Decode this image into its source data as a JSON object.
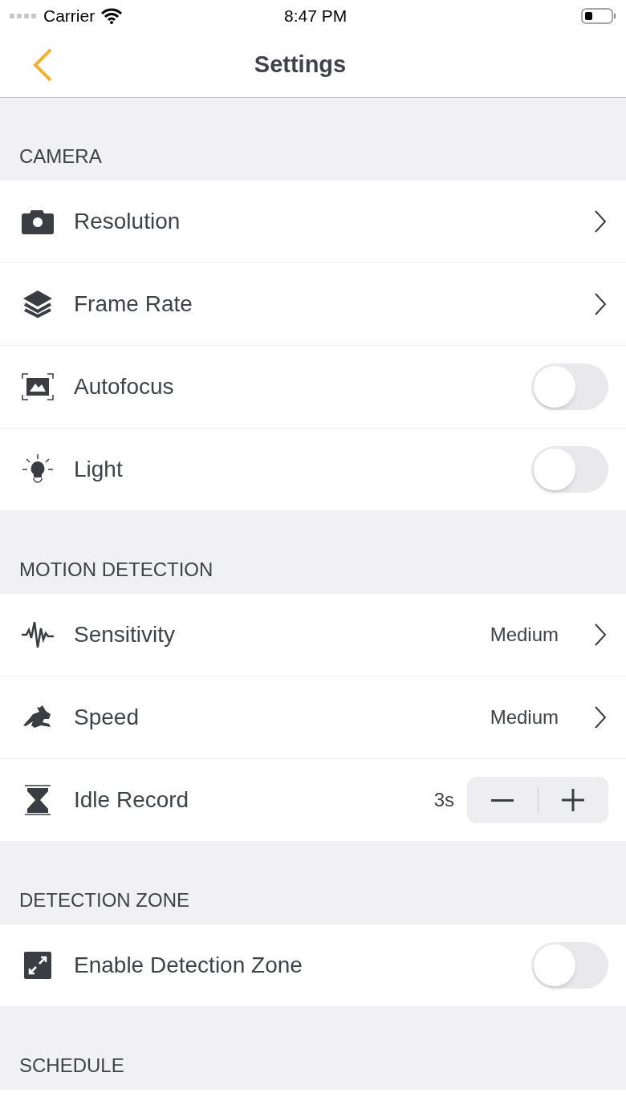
{
  "status_bar": {
    "carrier": "Carrier",
    "time": "8:47 PM"
  },
  "nav": {
    "title": "Settings"
  },
  "sections": [
    {
      "header": "CAMERA",
      "rows": [
        {
          "kind": "chevron",
          "label": "Resolution"
        },
        {
          "kind": "chevron",
          "label": "Frame Rate"
        },
        {
          "kind": "toggle",
          "label": "Autofocus",
          "on": false
        },
        {
          "kind": "toggle",
          "label": "Light",
          "on": false
        }
      ]
    },
    {
      "header": "MOTION DETECTION",
      "rows": [
        {
          "kind": "chevron",
          "label": "Sensitivity",
          "value": "Medium"
        },
        {
          "kind": "chevron",
          "label": "Speed",
          "value": "Medium"
        },
        {
          "kind": "stepper",
          "label": "Idle Record",
          "value": "3s"
        }
      ]
    },
    {
      "header": "DETECTION ZONE",
      "rows": [
        {
          "kind": "toggle",
          "label": "Enable Detection Zone",
          "on": false
        }
      ]
    },
    {
      "header": "SCHEDULE"
    }
  ]
}
